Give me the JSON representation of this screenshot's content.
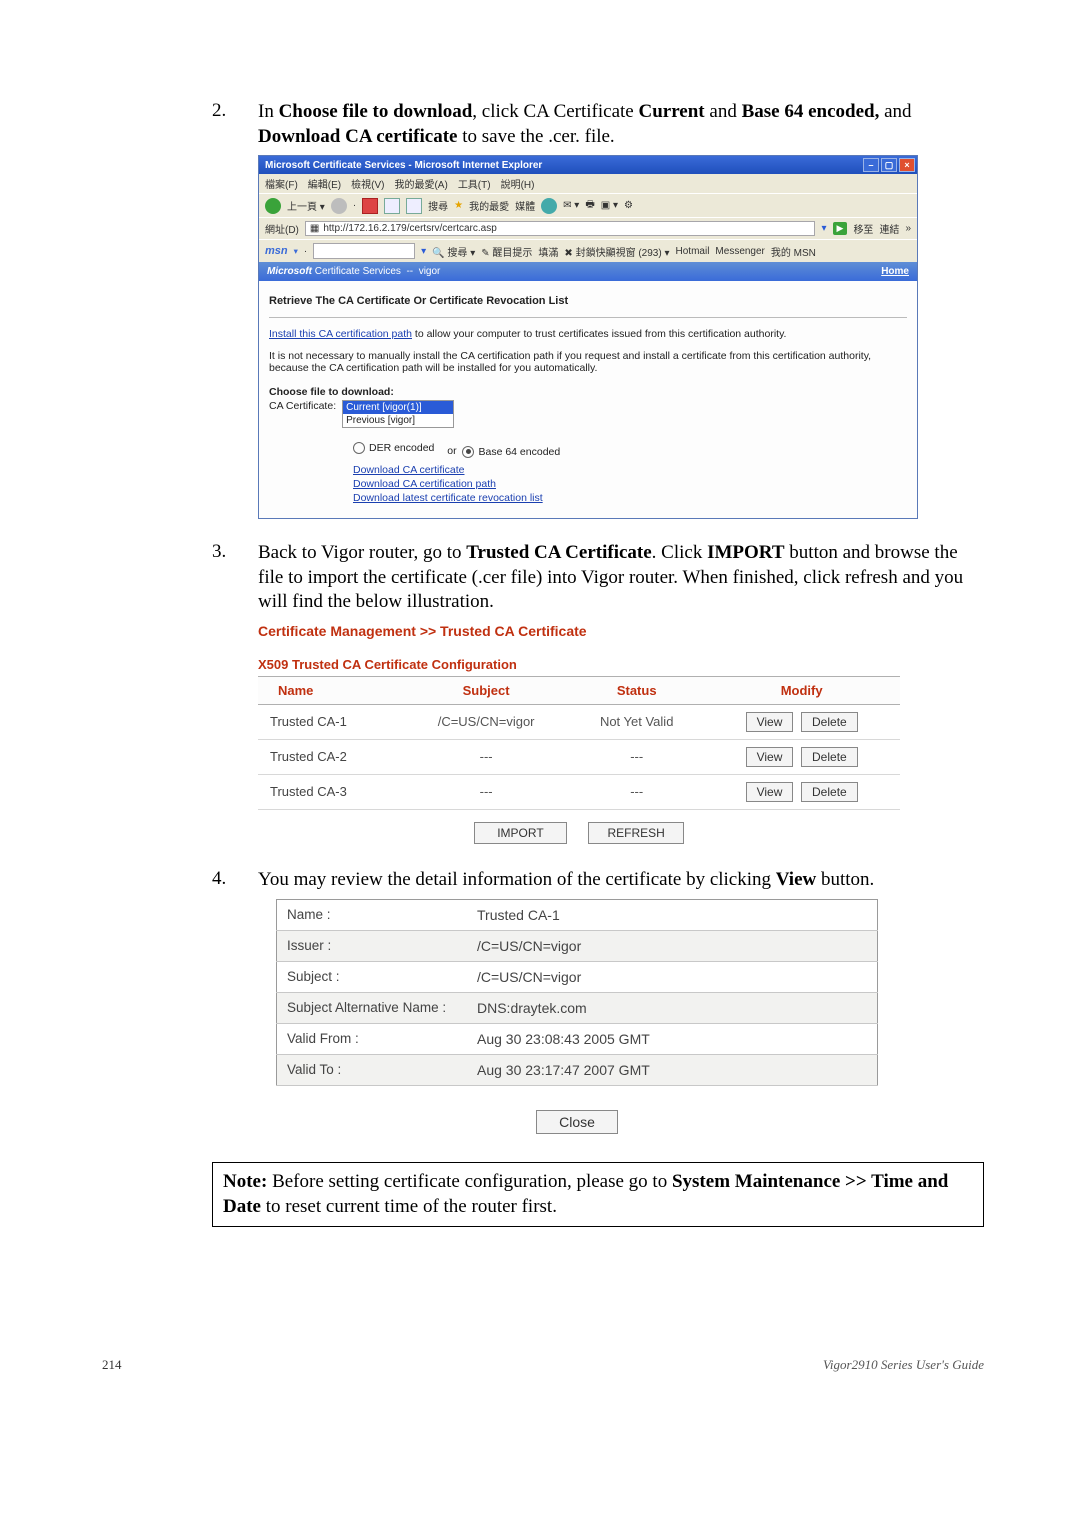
{
  "step2": {
    "num": "2.",
    "pre": "In ",
    "b1": "Choose file to download",
    "mid1": ", click CA Certificate ",
    "b2": "Current",
    "mid2": " and ",
    "b3": "Base 64 encoded,",
    "mid3": " and ",
    "b4": "Download CA certificate",
    "post": " to save the .cer. file."
  },
  "ie": {
    "title": "Microsoft Certificate Services - Microsoft Internet Explorer",
    "menu": [
      "檔案(F)",
      "編輯(E)",
      "檢視(V)",
      "我的最愛(A)",
      "工具(T)",
      "說明(H)"
    ],
    "tool": {
      "search": "搜尋",
      "fav": "我的最愛",
      "media": "媒體"
    },
    "addr_label": "網址(D)",
    "addr_value": "http://172.16.2.179/certsrv/certcarc.asp",
    "go": "移至",
    "links": "連結",
    "msn": {
      "logo": "msn",
      "search": "搜尋",
      "hl": "醒目提示",
      "fill": "填滿",
      "block": "封鎖快顯視窗 (293)",
      "hotmail": "Hotmail",
      "messenger": "Messenger",
      "my": "我的 MSN"
    },
    "msbar_left": "Microsoft Certificate Services  --  vigor",
    "msbar_right": "Home",
    "h4": "Retrieve The CA Certificate Or Certificate Revocation List",
    "p1a": "Install this CA certification path",
    "p1b": " to allow your computer to trust certificates issued from this certification authority.",
    "p2": "It is not necessary to manually install the CA certification path if you request and install a certificate from this certification authority, because the CA certification path will be installed for you automatically.",
    "choose": "Choose file to download:",
    "ca_label": "CA Certificate:",
    "opt_cur": "Current [vigor(1)]",
    "opt_prev": "Previous [vigor]",
    "enc_der": "DER encoded",
    "or": "or",
    "enc_b64": "Base 64 encoded",
    "dl1": "Download CA certificate",
    "dl2": "Download CA certification path",
    "dl3": "Download latest certificate revocation list"
  },
  "step3": {
    "num": "3.",
    "pre": "Back to Vigor router, go to ",
    "b1": "Trusted CA Certificate",
    "mid1": ". Click ",
    "b2": "IMPORT",
    "mid2": " button and browse the file to import the certificate (.cer file) into Vigor router. When finished, click refresh and you will find the below illustration."
  },
  "cm_title": "Certificate Management >> Trusted CA Certificate",
  "x509": {
    "head": "X509 Trusted CA Certificate Configuration",
    "cols": {
      "name": "Name",
      "subject": "Subject",
      "status": "Status",
      "modify": "Modify"
    },
    "rows": [
      {
        "name": "Trusted CA-1",
        "subject": "/C=US/CN=vigor",
        "status": "Not Yet Valid"
      },
      {
        "name": "Trusted CA-2",
        "subject": "---",
        "status": "---"
      },
      {
        "name": "Trusted CA-3",
        "subject": "---",
        "status": "---"
      }
    ],
    "btn_view": "View",
    "btn_delete": "Delete",
    "btn_import": "IMPORT",
    "btn_refresh": "REFRESH"
  },
  "step4": {
    "num": "4.",
    "pre": "You may review the detail information of the certificate by clicking ",
    "b1": "View",
    "post": " button."
  },
  "detail": {
    "rows": [
      {
        "k": "Name :",
        "v": "Trusted CA-1"
      },
      {
        "k": "Issuer :",
        "v": "/C=US/CN=vigor"
      },
      {
        "k": "Subject :",
        "v": "/C=US/CN=vigor"
      },
      {
        "k": "Subject Alternative Name :",
        "v": "DNS:draytek.com"
      },
      {
        "k": "Valid From :",
        "v": "Aug 30 23:08:43 2005 GMT"
      },
      {
        "k": "Valid To :",
        "v": "Aug 30 23:17:47 2007 GMT"
      }
    ],
    "close": "Close"
  },
  "note": {
    "b1": "Note:",
    "t1": " Before setting certificate configuration, please go to ",
    "b2": "System Maintenance >> Time and Date",
    "t2": " to reset current time of the router first."
  },
  "footer": {
    "page": "214",
    "guide": "Vigor2910  Series  User's Guide"
  }
}
